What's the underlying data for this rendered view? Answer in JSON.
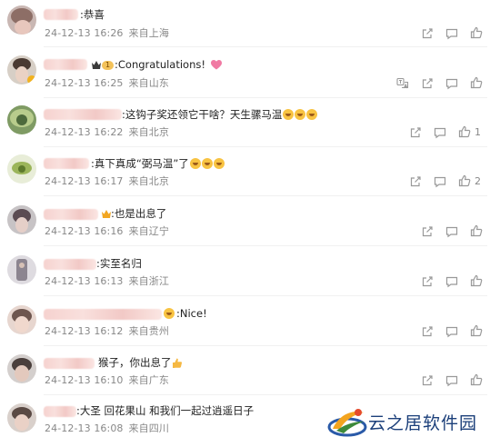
{
  "comments": [
    {
      "text": ":恭喜",
      "time": "24-12-13 16:26",
      "location": "来自上海",
      "actions": [
        "share",
        "comment",
        "like"
      ],
      "likes": ""
    },
    {
      "text": ":Congratulations!",
      "time": "24-12-13 16:25",
      "location": "来自山东",
      "actions": [
        "translate",
        "share",
        "comment",
        "like"
      ],
      "likes": "",
      "badge": "1"
    },
    {
      "text": ":这钩子奖还领它干啥？天生骡马温",
      "time": "24-12-13 16:22",
      "location": "来自北京",
      "actions": [
        "share",
        "comment",
        "like"
      ],
      "likes": "1"
    },
    {
      "text": ":真下真成“弼马温”了",
      "time": "24-12-13 16:17",
      "location": "来自北京",
      "actions": [
        "share",
        "comment",
        "like"
      ],
      "likes": "2"
    },
    {
      "text": ":也是出息了",
      "time": "24-12-13 16:16",
      "location": "来自辽宁",
      "actions": [
        "share",
        "comment",
        "like"
      ],
      "likes": ""
    },
    {
      "text": ":实至名归",
      "time": "24-12-13 16:13",
      "location": "来自浙江",
      "actions": [
        "share",
        "comment",
        "like"
      ],
      "likes": ""
    },
    {
      "text": ":Nice!",
      "time": "24-12-13 16:12",
      "location": "来自贵州",
      "actions": [
        "share",
        "comment",
        "like"
      ],
      "likes": ""
    },
    {
      "text": "猴子，你出息了",
      "time": "24-12-13 16:10",
      "location": "来自广东",
      "actions": [
        "share",
        "comment",
        "like"
      ],
      "likes": ""
    },
    {
      "text": ":大圣 回花果山 和我们一起过逍遥日子",
      "time": "24-12-13 16:08",
      "location": "来自四川",
      "actions": [],
      "likes": ""
    }
  ],
  "watermark": {
    "text": "云之居软件园"
  },
  "colors": {
    "meta": "#888888",
    "text": "#222222",
    "watermark": "#1b3f7a"
  }
}
